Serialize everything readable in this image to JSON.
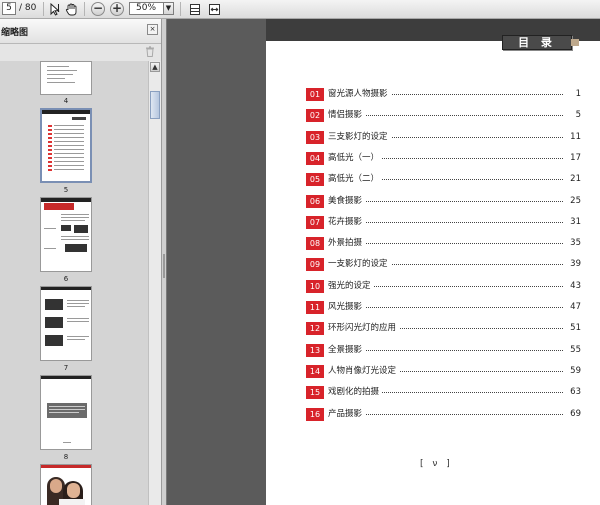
{
  "toolbar": {
    "current_page": "5",
    "total_pages": "/ 80",
    "zoom": "50%",
    "icons": [
      "select-cursor-icon",
      "hand-tool-icon",
      "zoom-out-icon",
      "zoom-in-icon",
      "fit-page-icon",
      "fit-width-icon"
    ]
  },
  "sidebar": {
    "title": "缩略图",
    "thumbnails": [
      "4",
      "5",
      "6",
      "7",
      "8"
    ]
  },
  "document": {
    "heading": "目 录",
    "footer": "[ ν ]",
    "toc": [
      {
        "num": "01",
        "title": "窗光源人物摄影",
        "page": "1"
      },
      {
        "num": "02",
        "title": "情侣摄影",
        "page": "5"
      },
      {
        "num": "03",
        "title": "三支影灯的设定",
        "page": "11"
      },
      {
        "num": "04",
        "title": "高低光（一）",
        "page": "17"
      },
      {
        "num": "05",
        "title": "高低光（二）",
        "page": "21"
      },
      {
        "num": "06",
        "title": "美食摄影",
        "page": "25"
      },
      {
        "num": "07",
        "title": "花卉摄影",
        "page": "31"
      },
      {
        "num": "08",
        "title": "外景拍摄",
        "page": "35"
      },
      {
        "num": "09",
        "title": "一支影灯的设定",
        "page": "39"
      },
      {
        "num": "10",
        "title": "强光的设定",
        "page": "43"
      },
      {
        "num": "11",
        "title": "风光摄影",
        "page": "47"
      },
      {
        "num": "12",
        "title": "环形闪光灯的应用",
        "page": "51"
      },
      {
        "num": "13",
        "title": "全景摄影",
        "page": "55"
      },
      {
        "num": "14",
        "title": "人物肖像灯光设定",
        "page": "59"
      },
      {
        "num": "15",
        "title": "戏剧化的拍摄",
        "page": "63"
      },
      {
        "num": "16",
        "title": "产品摄影",
        "page": "69"
      }
    ]
  }
}
